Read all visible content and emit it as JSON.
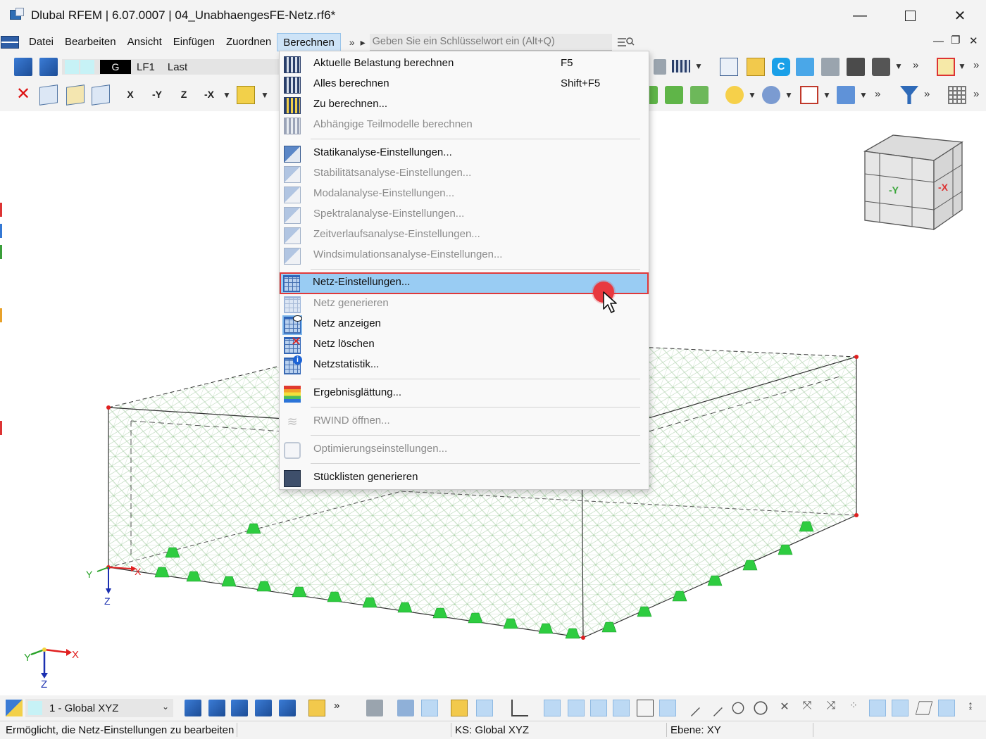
{
  "window": {
    "title": "Dlubal RFEM | 6.07.0007 | 04_UnabhaengesFE-Netz.rf6*",
    "minimize": "—",
    "close": "✕"
  },
  "menubar": {
    "items": [
      "Datei",
      "Bearbeiten",
      "Ansicht",
      "Einfügen",
      "Zuordnen",
      "Berechnen"
    ],
    "active": "Berechnen",
    "more": "»",
    "arrow": "▸",
    "search_placeholder": "Geben Sie ein Schlüsselwort ein (Alt+Q)",
    "mdi_minimize": "—",
    "mdi_restore": "❐",
    "mdi_close": "✕"
  },
  "toolbar": {
    "load_case_group": "G",
    "load_case_id": "LF1",
    "load_case_name": "Last",
    "axis_x": "X",
    "axis_neg_y": "-Y",
    "axis_z": "Z",
    "axis_neg_x": "-X",
    "more": "»"
  },
  "dropdown": {
    "items": [
      {
        "label": "Aktuelle Belastung berechnen",
        "shortcut": "F5",
        "enabled": true,
        "icon": "calculate-current-icon"
      },
      {
        "label": "Alles berechnen",
        "shortcut": "Shift+F5",
        "enabled": true,
        "icon": "calculate-all-icon"
      },
      {
        "label": "Zu berechnen...",
        "shortcut": "",
        "enabled": true,
        "icon": "to-calculate-icon"
      },
      {
        "label": "Abhängige Teilmodelle berechnen",
        "shortcut": "",
        "enabled": false,
        "icon": "dependent-submodels-icon"
      },
      {
        "label": "Statikanalyse-Einstellungen...",
        "shortcut": "",
        "enabled": true,
        "icon": "static-analysis-settings-icon"
      },
      {
        "label": "Stabilitätsanalyse-Einstellungen...",
        "shortcut": "",
        "enabled": false,
        "icon": "stability-analysis-settings-icon"
      },
      {
        "label": "Modalanalyse-Einstellungen...",
        "shortcut": "",
        "enabled": false,
        "icon": "modal-analysis-settings-icon"
      },
      {
        "label": "Spektralanalyse-Einstellungen...",
        "shortcut": "",
        "enabled": false,
        "icon": "spectral-analysis-settings-icon"
      },
      {
        "label": "Zeitverlaufsanalyse-Einstellungen...",
        "shortcut": "",
        "enabled": false,
        "icon": "time-history-settings-icon"
      },
      {
        "label": "Windsimulationsanalyse-Einstellungen...",
        "shortcut": "",
        "enabled": false,
        "icon": "wind-simulation-settings-icon"
      },
      {
        "label": "Netz-Einstellungen...",
        "shortcut": "",
        "enabled": true,
        "icon": "mesh-settings-icon",
        "highlighted": true
      },
      {
        "label": "Netz generieren",
        "shortcut": "",
        "enabled": false,
        "icon": "generate-mesh-icon"
      },
      {
        "label": "Netz anzeigen",
        "shortcut": "",
        "enabled": true,
        "icon": "show-mesh-icon"
      },
      {
        "label": "Netz löschen",
        "shortcut": "",
        "enabled": true,
        "icon": "delete-mesh-icon"
      },
      {
        "label": "Netzstatistik...",
        "shortcut": "",
        "enabled": true,
        "icon": "mesh-statistics-icon"
      },
      {
        "label": "Ergebnisglättung...",
        "shortcut": "",
        "enabled": true,
        "icon": "result-smoothing-icon"
      },
      {
        "label": "RWIND öffnen...",
        "shortcut": "",
        "enabled": false,
        "icon": "rwind-icon"
      },
      {
        "label": "Optimierungseinstellungen...",
        "shortcut": "",
        "enabled": false,
        "icon": "optimization-settings-icon"
      },
      {
        "label": "Stücklisten generieren",
        "shortcut": "",
        "enabled": true,
        "icon": "parts-list-icon"
      }
    ]
  },
  "viewport": {
    "axis_labels": {
      "x": "X",
      "y": "Y",
      "z": "Z"
    },
    "navcube_faces": {
      "front": "-Y",
      "right": "-X"
    },
    "colors": {
      "mesh": "#b7d6b5",
      "support": "#2ecc40",
      "node": "#e02020",
      "edge": "#333333"
    }
  },
  "bottombar": {
    "coordinate_system": "1 - Global XYZ",
    "caret": "⌄",
    "more": "»"
  },
  "statusbar": {
    "message": "Ermöglicht, die Netz-Einstellungen zu bearbeiten",
    "ks": "KS: Global XYZ",
    "plane": "Ebene: XY"
  }
}
